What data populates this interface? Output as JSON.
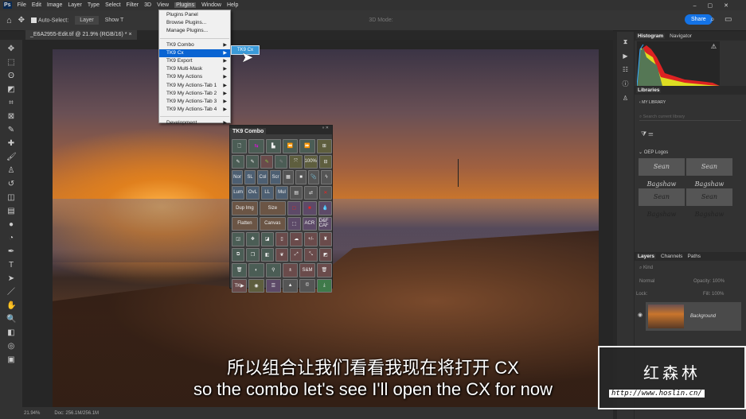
{
  "menubar": {
    "items": [
      "File",
      "Edit",
      "Image",
      "Layer",
      "Type",
      "Select",
      "Filter",
      "3D",
      "View",
      "Plugins",
      "Window",
      "Help"
    ]
  },
  "options": {
    "auto_select": "Auto-Select:",
    "layer": "Layer",
    "show": "Show T",
    "mode3d": "3D Mode:",
    "share": "Share"
  },
  "document": {
    "tab": "_E6A2955-Edit.tif @ 21.9% (RGB/16) *",
    "zoom": "21.94%",
    "doc": "Doc: 256.1M/256.1M"
  },
  "plugins_menu": {
    "items": [
      {
        "label": "Plugins Panel"
      },
      {
        "label": "Browse Plugins..."
      },
      {
        "label": "Manage Plugins..."
      },
      {
        "label": "TK9 Combo",
        "sub": true
      },
      {
        "label": "TK9 Cx",
        "sub": true,
        "highlighted": true
      },
      {
        "label": "TK9 Export",
        "sub": true
      },
      {
        "label": "TK9 Multi-Mask",
        "sub": true
      },
      {
        "label": "TK9 My Actions",
        "sub": true
      },
      {
        "label": "TK9 My Actions-Tab 1",
        "sub": true
      },
      {
        "label": "TK9 My Actions-Tab 2",
        "sub": true
      },
      {
        "label": "TK9 My Actions-Tab 3",
        "sub": true
      },
      {
        "label": "TK9 My Actions-Tab 4",
        "sub": true
      },
      {
        "label": "Development",
        "sub": true
      }
    ],
    "submenu": "TK9 Cx"
  },
  "combo": {
    "title": "TK9 Combo",
    "labels": {
      "zoom100": "100%",
      "nor": "Nor",
      "sl": "SL",
      "col": "Col",
      "scr": "Scr",
      "lum": "Lum",
      "ovl": "OvL",
      "ll": "LL",
      "mul": "Mul",
      "dup": "Dup Img",
      "size": "Size",
      "flatten": "Flatten",
      "canvas": "Canvas",
      "acr": "ACR",
      "dfcaf": "D&F CAF",
      "pm": "+/-",
      "sm": "S&M",
      "tk": "TK▶"
    }
  },
  "panels": {
    "histogram": "Histogram",
    "navigator": "Navigator",
    "libraries": "Libraries",
    "my_library": "MY LIBRARY",
    "search_placeholder": "Search current library",
    "oep": "OEP Logos",
    "signature": "Sean Bagshaw",
    "layers": "Layers",
    "channels": "Channels",
    "paths": "Paths",
    "kind": "Kind",
    "normal": "Normal",
    "opacity": "Opacity:",
    "opacity_val": "100%",
    "lock": "Lock:",
    "fill": "Fill:",
    "fill_val": "100%",
    "layer_name": "Background"
  },
  "subtitles": {
    "zh": "所以组合让我们看看我现在将打开 CX",
    "en": "so the combo let's see I'll open the CX for now"
  },
  "watermark": {
    "name": "红森林",
    "url": "http://www.hoslin.cn/"
  }
}
